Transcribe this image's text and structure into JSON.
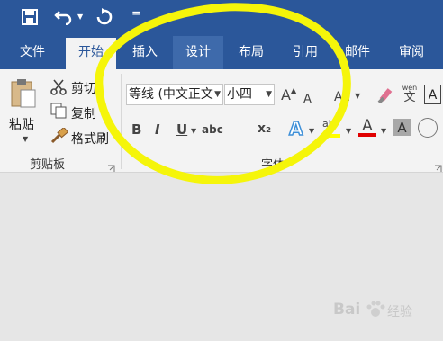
{
  "qat": {
    "more": "="
  },
  "tabs": [
    {
      "label": "文件"
    },
    {
      "label": "开始"
    },
    {
      "label": "插入"
    },
    {
      "label": "设计"
    },
    {
      "label": "布局"
    },
    {
      "label": "引用"
    },
    {
      "label": "邮件"
    },
    {
      "label": "审阅"
    }
  ],
  "clipboard": {
    "paste_label": "粘贴",
    "cut_label": "剪切",
    "copy_label": "复制",
    "format_painter_label": "格式刷",
    "group_label": "剪贴板"
  },
  "font": {
    "font_name": "等线 (中文正文",
    "font_size": "小四",
    "case_label": "Aa",
    "phonetic_top": "wén",
    "phonetic_bottom": "文",
    "border_char": "A",
    "bold": "B",
    "italic": "I",
    "underline": "U",
    "strike": "abc",
    "subscript": "x₂",
    "effects_char": "A",
    "highlight_char": "ab",
    "color_char": "A",
    "shading_char": "A",
    "group_label": "字体",
    "grow": "A",
    "shrink": "A"
  },
  "watermark": {
    "brand": "Bai",
    "brand2": "经验"
  },
  "colors": {
    "title_bar": "#2b579a",
    "tab_hover": "#3e6aab",
    "annotation": "#f5f50a",
    "font_color": "#e00000",
    "highlight": "#ffff00",
    "text_effects": "#3d8fd8"
  }
}
